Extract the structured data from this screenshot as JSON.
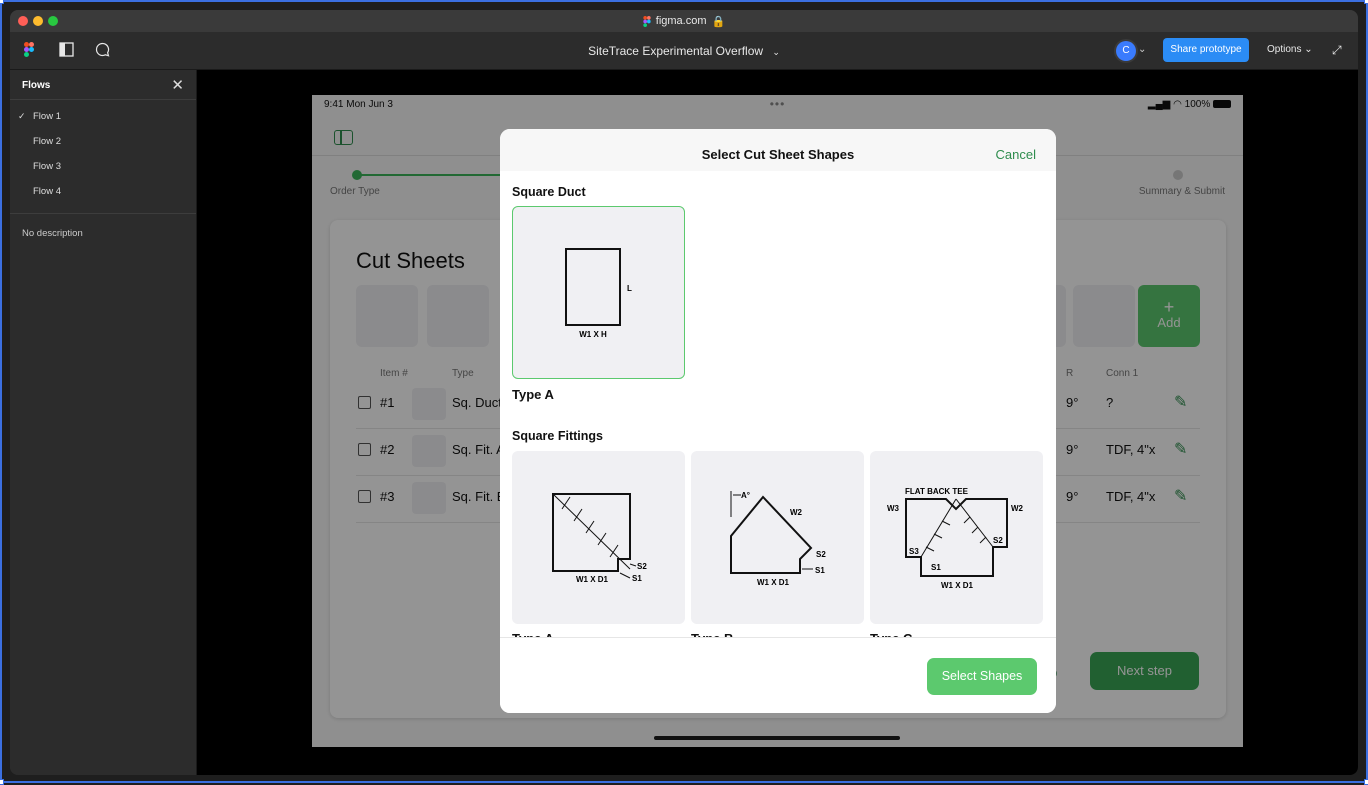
{
  "browser": {
    "url": "figma.com"
  },
  "figma": {
    "file_title": "SiteTrace Experimental Overflow",
    "avatar_initial": "C",
    "share_label": "Share prototype",
    "options_label": "Options"
  },
  "sidebar": {
    "title": "Flows",
    "flows": [
      {
        "label": "Flow 1",
        "checked": true
      },
      {
        "label": "Flow 2",
        "checked": false
      },
      {
        "label": "Flow 3",
        "checked": false
      },
      {
        "label": "Flow 4",
        "checked": false
      }
    ],
    "description": "No description"
  },
  "ipad": {
    "status_time": "9:41 Mon Jun 3",
    "status_right": "100%",
    "steps": {
      "first": "Order Type",
      "last": "Summary & Submit"
    },
    "card_title": "Cut Sheets",
    "add_label": "Add",
    "columns": {
      "item": "Item #",
      "type": "Type",
      "r": "R",
      "conn1": "Conn 1"
    },
    "rows": [
      {
        "num": "#1",
        "type": "Sq. Duct",
        "r": "9°",
        "conn1": "?"
      },
      {
        "num": "#2",
        "type": "Sq. Fit. A",
        "r": "9°",
        "conn1": "TDF, 4\"x"
      },
      {
        "num": "#3",
        "type": "Sq. Fit. B",
        "r": "9°",
        "conn1": "TDF, 4\"x"
      }
    ],
    "back_partial": "p",
    "next_label": "Next step"
  },
  "modal": {
    "title": "Select Cut Sheet Shapes",
    "cancel_label": "Cancel",
    "square_duct": {
      "section_title": "Square Duct",
      "items": [
        {
          "type_label": "Type A",
          "dim_label": "W1 X H",
          "side_label": "L",
          "selected": true
        }
      ]
    },
    "square_fittings": {
      "section_title": "Square Fittings",
      "items": [
        {
          "type_label": "Type A",
          "dim_label": "W1 X D1",
          "s1": "S1",
          "s2": "S2"
        },
        {
          "type_label": "Type B",
          "dim_label": "W1 X D1",
          "s1": "S1",
          "s2": "S2",
          "w2": "W2",
          "angle": "A°"
        },
        {
          "type_label": "Type C",
          "dim_label": "W1 X D1",
          "s1": "S1",
          "s2": "S2",
          "s3": "S3",
          "w2": "W2",
          "w3": "W3",
          "caption": "FLAT BACK TEE"
        }
      ]
    },
    "select_label": "Select Shapes"
  }
}
